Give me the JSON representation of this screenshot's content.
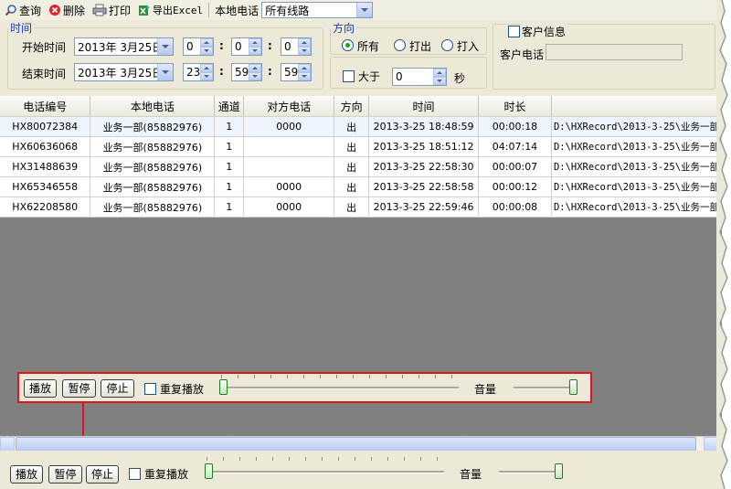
{
  "toolbar": {
    "query_label": "查询",
    "delete_label": "删除",
    "print_label": "打印",
    "export_label": "导出Excel",
    "local_phone_label": "本地电话",
    "line_value": "所有线路"
  },
  "filter": {
    "time_legend": "时间",
    "start_label": "开始时间",
    "end_label": "结束时间",
    "start_date": "2013年 3月25日",
    "end_date": "2013年 3月25日",
    "start_h": "0",
    "start_m": "0",
    "start_s": "0",
    "end_h": "23",
    "end_m": "59",
    "end_s": "59",
    "colon": ":",
    "direction_legend": "方向",
    "dir_all": "所有",
    "dir_out": "打出",
    "dir_in": "打入",
    "greater_label": "大于",
    "greater_value": "0",
    "sec_label": "秒",
    "customer_legend": "客户信息",
    "customer_phone_label": "客户电话",
    "customer_phone_value": ""
  },
  "grid": {
    "columns": [
      "电话编号",
      "本地电话",
      "通道",
      "对方电话",
      "方向",
      "时间",
      "时长",
      ""
    ],
    "rows": [
      {
        "id": "HX80072384",
        "local": "业务一部(85882976)",
        "ch": "1",
        "peer": "0000",
        "dir": "出",
        "time": "2013-3-25 18:48:59",
        "dur": "00:00:18",
        "path": "D:\\HXRecord\\2013-3-25\\业务一部"
      },
      {
        "id": "HX60636068",
        "local": "业务一部(85882976)",
        "ch": "1",
        "peer": "",
        "dir": "出",
        "time": "2013-3-25 18:51:12",
        "dur": "04:07:14",
        "path": "D:\\HXRecord\\2013-3-25\\业务一部"
      },
      {
        "id": "HX31488639",
        "local": "业务一部(85882976)",
        "ch": "1",
        "peer": "",
        "dir": "出",
        "time": "2013-3-25 22:58:30",
        "dur": "00:00:07",
        "path": "D:\\HXRecord\\2013-3-25\\业务一部"
      },
      {
        "id": "HX65346558",
        "local": "业务一部(85882976)",
        "ch": "1",
        "peer": "0000",
        "dir": "出",
        "time": "2013-3-25 22:58:58",
        "dur": "00:00:12",
        "path": "D:\\HXRecord\\2013-3-25\\业务一部"
      },
      {
        "id": "HX62208580",
        "local": "业务一部(85882976)",
        "ch": "1",
        "peer": "0000",
        "dir": "出",
        "time": "2013-3-25 22:59:46",
        "dur": "00:00:08",
        "path": "D:\\HXRecord\\2013-3-25\\业务一部"
      }
    ]
  },
  "player": {
    "play_label": "播放",
    "pause_label": "暂停",
    "stop_label": "停止",
    "repeat_label": "重复播放",
    "volume_label": "音量",
    "progress": 0,
    "volume": 1.0
  },
  "colors": {
    "highlight": "#d9161c",
    "legend": "#1a3fb0",
    "grid_bg": "#808080"
  }
}
